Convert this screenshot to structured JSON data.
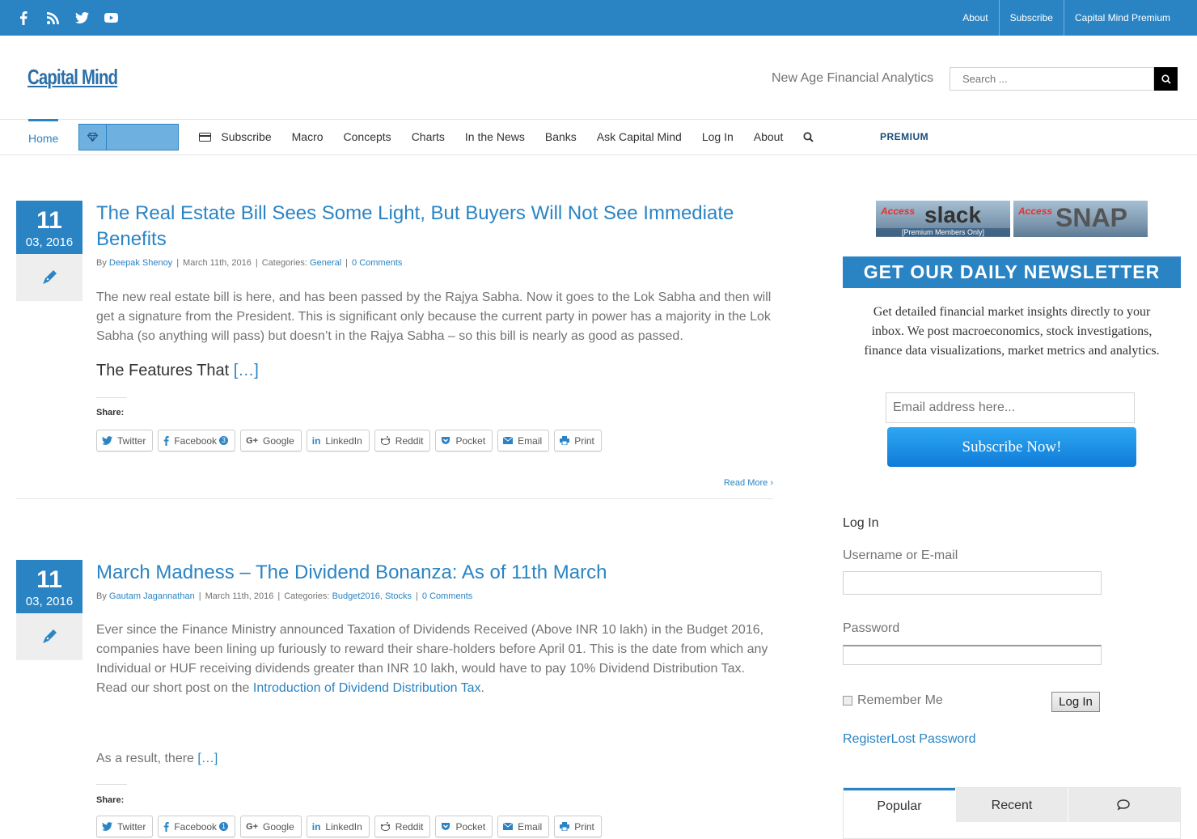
{
  "topbar": {
    "social": [
      "facebook-icon",
      "rss-icon",
      "twitter-icon",
      "youtube-icon"
    ],
    "links": [
      "About",
      "Subscribe",
      "Capital Mind Premium"
    ]
  },
  "header": {
    "logo": "Capital Mind",
    "tagline": "New Age Financial Analytics",
    "search_placeholder": "Search ..."
  },
  "nav": {
    "home": "Home",
    "premium": "PREMIUM",
    "items": [
      "Subscribe",
      "Macro",
      "Concepts",
      "Charts",
      "In the News",
      "Banks",
      "Ask Capital Mind",
      "Log In",
      "About"
    ]
  },
  "posts": [
    {
      "day": "11",
      "month_year": "03, 2016",
      "title": "The Real Estate Bill Sees Some Light, But Buyers Will Not See Immediate Benefits",
      "by": "By",
      "author": "Deepak Shenoy",
      "date": "March 11th, 2016",
      "categories_label": "Categories:",
      "categories": "General",
      "comments": "0 Comments",
      "excerpt": "The new real estate bill is here, and has been passed by the Rajya Sabha. Now it goes to the Lok Sabha and then will get a signature from the President. This is significant only because the current party in power has a majority in the Lok Sabha (so anything will pass) but doesn’t in the Rajya Sabha – so this bill is nearly as good as passed.",
      "lead": "The Features That",
      "more": "[…]",
      "share_label": "Share:",
      "facebook_count": "3",
      "read_more": "Read More"
    },
    {
      "day": "11",
      "month_year": "03, 2016",
      "title": "March Madness – The Dividend Bonanza: As of 11th March",
      "by": "By",
      "author": "Gautam Jagannathan",
      "date": "March 11th, 2016",
      "categories_label": "Categories:",
      "cat1": "Budget2016",
      "cat2": "Stocks",
      "comments": "0 Comments",
      "excerpt": "Ever since the Finance Ministry announced Taxation of Dividends Received (Above INR 10 lakh) in the Budget 2016, companies have been lining up furiously to reward their share-holders before April 01. This is the date from which any Individual or HUF receiving dividends greater than INR 10 lakh, would have to pay 10% Dividend Distribution Tax. Read our short post on the",
      "excerpt_link": "Introduction of Dividend Distribution Tax",
      "excerpt_end": ".",
      "lead": "As a result, there",
      "more": "[…]",
      "share_label": "Share:",
      "facebook_count": "1"
    }
  ],
  "share_buttons": [
    "Twitter",
    "Facebook",
    "Google",
    "LinkedIn",
    "Reddit",
    "Pocket",
    "Email",
    "Print"
  ],
  "sidebar": {
    "banner1_access": "Access",
    "banner1_brand": "slack",
    "banner1_note": "[Premium Members Only]",
    "banner2_access": "Access",
    "banner2_brand": "SNAP",
    "newsletter_title": "GET OUR DAILY NEWSLETTER",
    "newsletter_text": "Get detailed financial market insights directly to your inbox. We post macroeconomics, stock investigations, finance data visualizations, market metrics and analytics.",
    "email_placeholder": "Email address here...",
    "subscribe_btn": "Subscribe Now!",
    "login_title": "Log In",
    "username_label": "Username or E-mail",
    "password_label": "Password",
    "remember_label": "Remember Me",
    "login_btn": "Log In",
    "register": "Register",
    "lost_password": "Lost Password",
    "tabs": [
      "Popular",
      "Recent"
    ]
  },
  "colors": {
    "accent": "#2a84c4",
    "text": "#747474"
  }
}
